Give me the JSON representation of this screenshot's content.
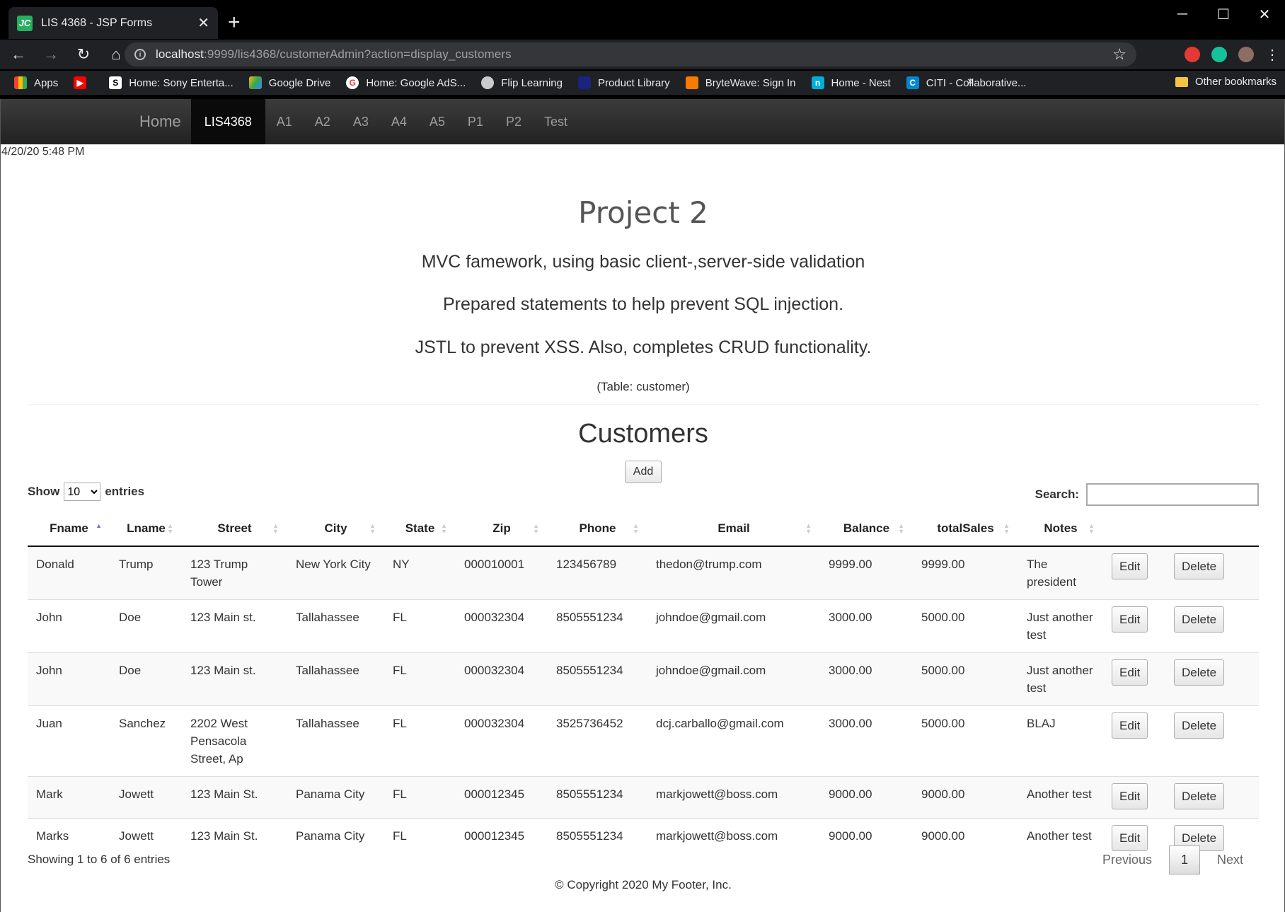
{
  "browser": {
    "tab_title": "LIS 4368 - JSP Forms",
    "tab_favicon": "JC",
    "url_host": "localhost",
    "url_rest": ":9999/lis4368/customerAdmin?action=display_customers",
    "bookmarks": [
      "Apps",
      "",
      "Home: Sony Enterta...",
      "Google Drive",
      "Home: Google AdS...",
      "Flip Learning",
      "Product Library",
      "BryteWave: Sign In",
      "Home - Nest",
      "CITI - Collaborative..."
    ],
    "bookmark_more": "»",
    "other_bookmarks": "Other bookmarks"
  },
  "nav": {
    "brand": "Home",
    "items": [
      "LIS4368",
      "A1",
      "A2",
      "A3",
      "A4",
      "A5",
      "P1",
      "P2",
      "Test"
    ]
  },
  "page": {
    "timestamp": "4/20/20 5:48 PM",
    "title": "Project 2",
    "lead1": "MVC famework, using basic client-,server-side validation",
    "lead2": "Prepared statements to help prevent SQL injection.",
    "lead3": "JSTL to prevent XSS. Also, completes CRUD functionality.",
    "table_note": "(Table: customer)",
    "section_title": "Customers",
    "add_label": "Add",
    "show_label": "Show",
    "entries_value": "10",
    "entries_label": "entries",
    "search_label": "Search:",
    "info": "Showing 1 to 6 of 6 entries",
    "prev": "Previous",
    "page_num": "1",
    "next": "Next",
    "footer": "© Copyright 2020 My Footer, Inc."
  },
  "table": {
    "headers": [
      "Fname",
      "Lname",
      "Street",
      "City",
      "State",
      "Zip",
      "Phone",
      "Email",
      "Balance",
      "totalSales",
      "Notes"
    ],
    "edit_label": "Edit",
    "delete_label": "Delete",
    "rows": [
      [
        "Donald",
        "Trump",
        "123 Trump Tower",
        "New York City",
        "NY",
        "000010001",
        "123456789",
        "thedon@trump.com",
        "9999.00",
        "9999.00",
        "The president"
      ],
      [
        "John",
        "Doe",
        "123 Main st.",
        "Tallahassee",
        "FL",
        "000032304",
        "8505551234",
        "johndoe@gmail.com",
        "3000.00",
        "5000.00",
        "Just another test"
      ],
      [
        "John",
        "Doe",
        "123 Main st.",
        "Tallahassee",
        "FL",
        "000032304",
        "8505551234",
        "johndoe@gmail.com",
        "3000.00",
        "5000.00",
        "Just another test"
      ],
      [
        "Juan",
        "Sanchez",
        "2202 West Pensacola Street, Ap",
        "Tallahassee",
        "FL",
        "000032304",
        "3525736452",
        "dcj.carballo@gmail.com",
        "3000.00",
        "5000.00",
        "BLAJ"
      ],
      [
        "Mark",
        "Jowett",
        "123 Main St.",
        "Panama City",
        "FL",
        "000012345",
        "8505551234",
        "markjowett@boss.com",
        "9000.00",
        "9000.00",
        "Another test"
      ],
      [
        "Marks",
        "Jowett",
        "123 Main St.",
        "Panama City",
        "FL",
        "000012345",
        "8505551234",
        "markjowett@boss.com",
        "9000.00",
        "9000.00",
        "Another test"
      ]
    ]
  }
}
